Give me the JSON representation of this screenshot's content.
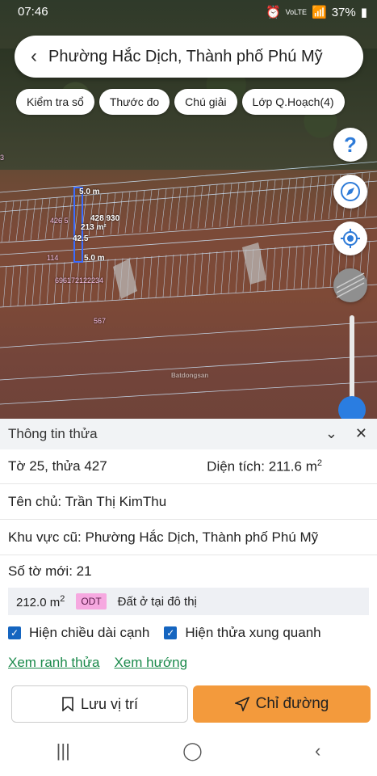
{
  "status_bar": {
    "time": "07:46",
    "network": "VoLTE",
    "battery": "37%"
  },
  "search": {
    "back_icon": "chevron-left-icon",
    "title": "Phường Hắc Dịch, Thành phố Phú Mỹ"
  },
  "chips": [
    "Kiểm tra sổ",
    "Thước đo",
    "Chú giải",
    "Lớp Q.Hoạch(4)"
  ],
  "map": {
    "labels": {
      "edge_top": "5.0 m",
      "edge_bottom": "5.0 m",
      "parcel_left": "426 5",
      "parcel_right": "428 930",
      "area": "213 m²",
      "side": "42.5",
      "parcel_114": "114",
      "parcel_long": "696172122234",
      "parcel_567": "567",
      "edge_number": "3",
      "watermark": "Batdongsan"
    },
    "help_label": "?"
  },
  "panel": {
    "title": "Thông tin thửa",
    "sheet_plot": "Tờ 25, thửa 427",
    "area_label": "Diện tích: 211.6 m",
    "area_sup": "2",
    "owner": "Tên chủ: Trần Thị KimThu",
    "old_area": "Khu vực cũ: Phường Hắc Dịch, Thành phố Phú Mỹ",
    "new_sheet": "Số tờ mới: 21",
    "zone": {
      "area": "212.0 m",
      "area_sup": "2",
      "code": "ODT",
      "desc": "Đất ở tại đô thị"
    },
    "check_edges": "Hiện chiều dài cạnh",
    "check_neighbors": "Hiện thửa xung quanh",
    "link_boundary": "Xem ranh thửa",
    "link_direction": "Xem hướng",
    "save_label": "Lưu vị trí",
    "route_label": "Chỉ đường"
  },
  "colors": {
    "primary": "#1565c0",
    "route_button": "#f39a3c",
    "link": "#1b8a4b",
    "badge": "#f6a8e0"
  }
}
